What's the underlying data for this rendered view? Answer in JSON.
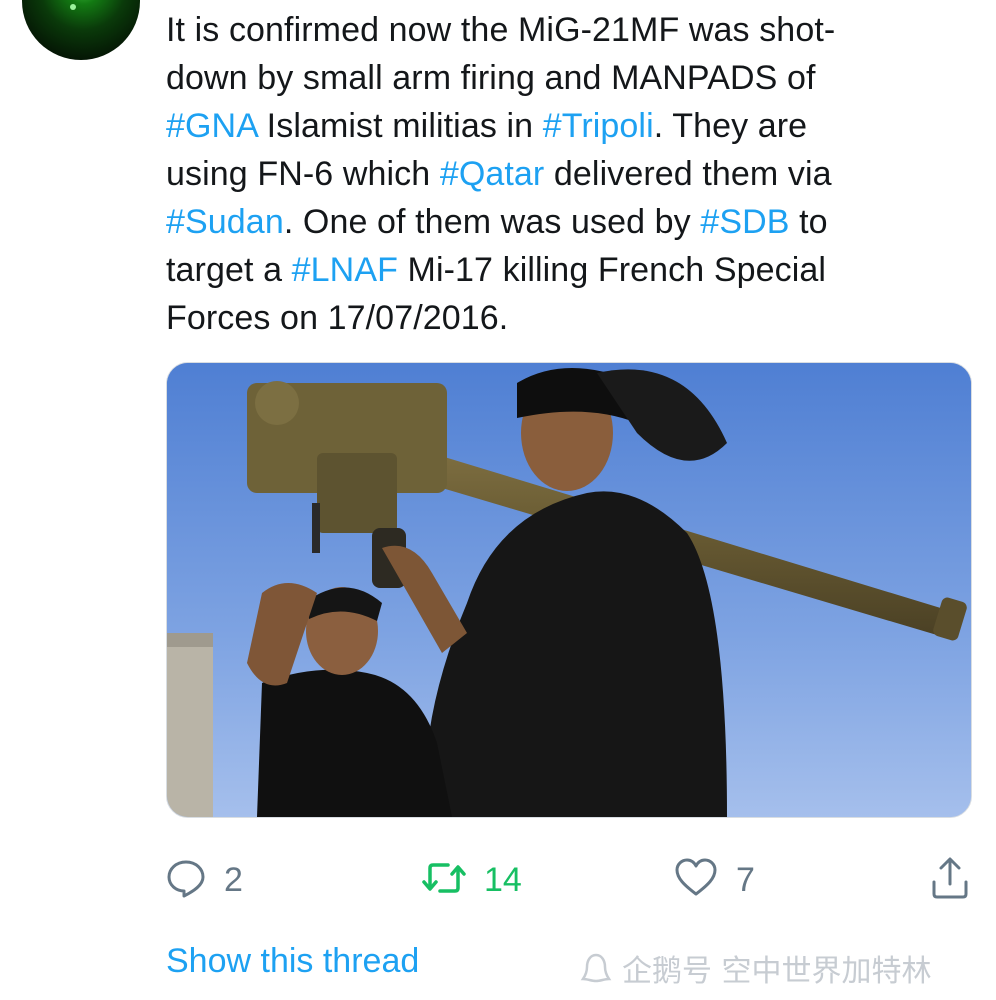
{
  "tweet": {
    "lines": [
      [
        {
          "text": "It is confirmed now the MiG-21MF was shot-",
          "tag": false
        }
      ],
      [
        {
          "text": "down by small arm firing and MANPADS of",
          "tag": false
        }
      ],
      [
        {
          "text": "#GNA",
          "tag": true
        },
        {
          "text": " Islamist militias in ",
          "tag": false
        },
        {
          "text": "#Tripoli",
          "tag": true
        },
        {
          "text": ". They are",
          "tag": false
        }
      ],
      [
        {
          "text": "using FN-6 which ",
          "tag": false
        },
        {
          "text": "#Qatar",
          "tag": true
        },
        {
          "text": " delivered them via",
          "tag": false
        }
      ],
      [
        {
          "text": "#Sudan",
          "tag": true
        },
        {
          "text": ". One of them was used by ",
          "tag": false
        },
        {
          "text": "#SDB",
          "tag": true
        },
        {
          "text": " to",
          "tag": false
        }
      ],
      [
        {
          "text": "target a ",
          "tag": false
        },
        {
          "text": "#LNAF",
          "tag": true
        },
        {
          "text": " Mi-17 killing French Special",
          "tag": false
        }
      ],
      [
        {
          "text": "Forces on 17/07/2016.",
          "tag": false
        }
      ]
    ]
  },
  "actions": {
    "reply_count": "2",
    "retweet_count": "14",
    "like_count": "7"
  },
  "icons": {
    "reply": "reply-icon",
    "retweet": "retweet-icon",
    "like": "heart-icon",
    "share": "share-icon"
  },
  "show_thread": "Show this thread",
  "watermark": "企鹅号 空中世界加特林",
  "colors": {
    "link": "#1da1f2",
    "retweet_active": "#17bf63",
    "icon_gray": "#657786",
    "text": "#14171a"
  }
}
